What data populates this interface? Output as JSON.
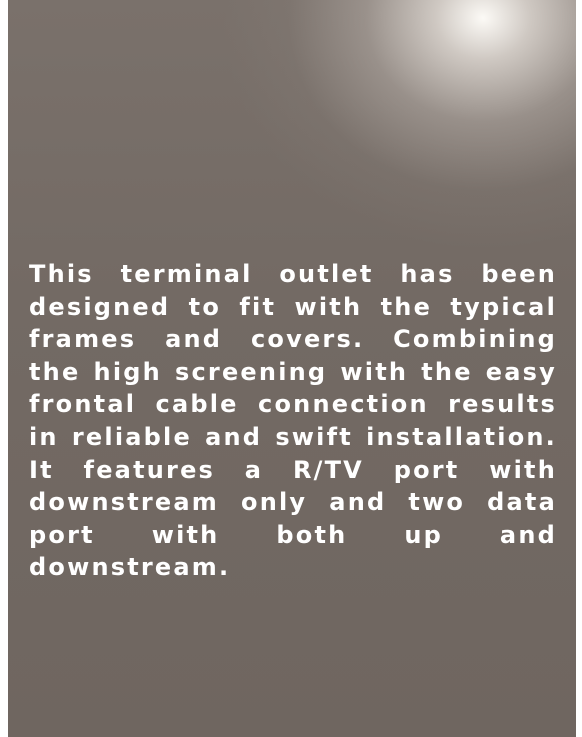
{
  "description": {
    "text": "This terminal outlet has been designed to fit with the typical frames and covers. Combining the high screening with the easy frontal cable connection results in reliable and swift installation. It features a R/TV port with downstream only and two data port with both up and downstream."
  },
  "colors": {
    "text": "#ffffff",
    "background": "#736a64",
    "highlight": "#fcfaf6"
  }
}
